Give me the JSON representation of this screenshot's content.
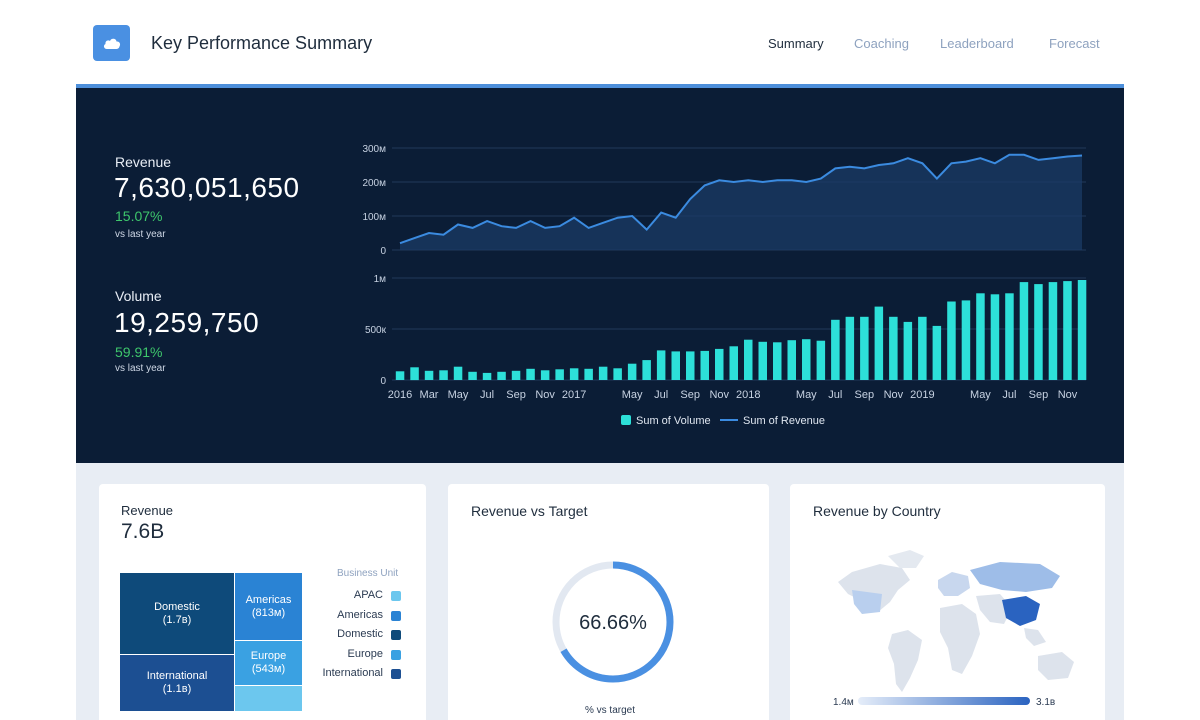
{
  "header": {
    "title": "Key Performance Summary",
    "nav": [
      "Summary",
      "Coaching",
      "Leaderboard",
      "Forecast"
    ],
    "active": "Summary"
  },
  "kpis": {
    "revenue": {
      "label": "Revenue",
      "value": "7,630,051,650",
      "change": "15.07%",
      "sub": "vs last year"
    },
    "volume": {
      "label": "Volume",
      "value": "19,259,750",
      "change": "59.91%",
      "sub": "vs last year"
    }
  },
  "colors": {
    "hero_bg": "#0b1d36",
    "revenue_line": "#3b8be0",
    "volume_bar": "#2de0d9",
    "positive": "#3ec66c"
  },
  "chart_data": {
    "type": "bar",
    "title": "",
    "legend": [
      "Sum of Volume",
      "Sum of Revenue"
    ],
    "legend_position": "bottom",
    "x_ticks": [
      {
        "i": 0,
        "label": "2016"
      },
      {
        "i": 2,
        "label": "Mar"
      },
      {
        "i": 4,
        "label": "May"
      },
      {
        "i": 6,
        "label": "Jul"
      },
      {
        "i": 8,
        "label": "Sep"
      },
      {
        "i": 10,
        "label": "Nov"
      },
      {
        "i": 12,
        "label": "2017"
      },
      {
        "i": 16,
        "label": "May"
      },
      {
        "i": 18,
        "label": "Jul"
      },
      {
        "i": 20,
        "label": "Sep"
      },
      {
        "i": 22,
        "label": "Nov"
      },
      {
        "i": 24,
        "label": "2018"
      },
      {
        "i": 28,
        "label": "May"
      },
      {
        "i": 30,
        "label": "Jul"
      },
      {
        "i": 32,
        "label": "Sep"
      },
      {
        "i": 34,
        "label": "Nov"
      },
      {
        "i": 36,
        "label": "2019"
      },
      {
        "i": 40,
        "label": "May"
      },
      {
        "i": 42,
        "label": "Jul"
      },
      {
        "i": 44,
        "label": "Sep"
      },
      {
        "i": 46,
        "label": "Nov"
      }
    ],
    "series": [
      {
        "name": "Sum of Revenue",
        "type": "area-line",
        "axis_ticks": [
          "0",
          "100м",
          "200м",
          "300м"
        ],
        "ylim": [
          0,
          300
        ],
        "values": [
          20,
          35,
          50,
          45,
          75,
          65,
          85,
          70,
          65,
          85,
          65,
          70,
          95,
          65,
          80,
          95,
          100,
          60,
          110,
          95,
          150,
          190,
          205,
          200,
          205,
          200,
          205,
          205,
          200,
          210,
          240,
          245,
          240,
          250,
          255,
          270,
          255,
          210,
          255,
          260,
          270,
          255,
          280,
          280,
          265,
          270,
          275,
          278
        ]
      },
      {
        "name": "Sum of Volume",
        "type": "bar",
        "axis_ticks": [
          "0",
          "500к",
          "1м"
        ],
        "ylim": [
          0,
          1000
        ],
        "values": [
          85,
          125,
          90,
          95,
          130,
          80,
          70,
          80,
          90,
          110,
          95,
          105,
          115,
          110,
          130,
          115,
          160,
          195,
          290,
          280,
          280,
          285,
          305,
          330,
          395,
          375,
          370,
          390,
          400,
          385,
          590,
          620,
          620,
          720,
          620,
          570,
          620,
          530,
          770,
          780,
          850,
          840,
          850,
          960,
          940,
          960,
          970,
          980
        ]
      }
    ]
  },
  "revenue_card": {
    "title": "Revenue",
    "value": "7.6B",
    "legend_title": "Business Unit",
    "units": [
      {
        "name": "APAC",
        "color": "#6cc7ee"
      },
      {
        "name": "Americas",
        "color": "#2a83d4"
      },
      {
        "name": "Domestic",
        "color": "#0e4a7a"
      },
      {
        "name": "Europe",
        "color": "#3aa1e2"
      },
      {
        "name": "International",
        "color": "#1c4f92"
      }
    ],
    "tiles": [
      {
        "name": "Domestic",
        "amount": "(1.7в)"
      },
      {
        "name": "International",
        "amount": "(1.1в)"
      },
      {
        "name": "Americas",
        "amount": "(813м)"
      },
      {
        "name": "Europe",
        "amount": "(543м)"
      }
    ]
  },
  "target_card": {
    "title": "Revenue vs Target",
    "percent_label": "66.66%",
    "percent": 66.66,
    "sub": "% vs target"
  },
  "country_card": {
    "title": "Revenue by Country",
    "scale_min": "1.4м",
    "scale_max": "3.1в"
  }
}
